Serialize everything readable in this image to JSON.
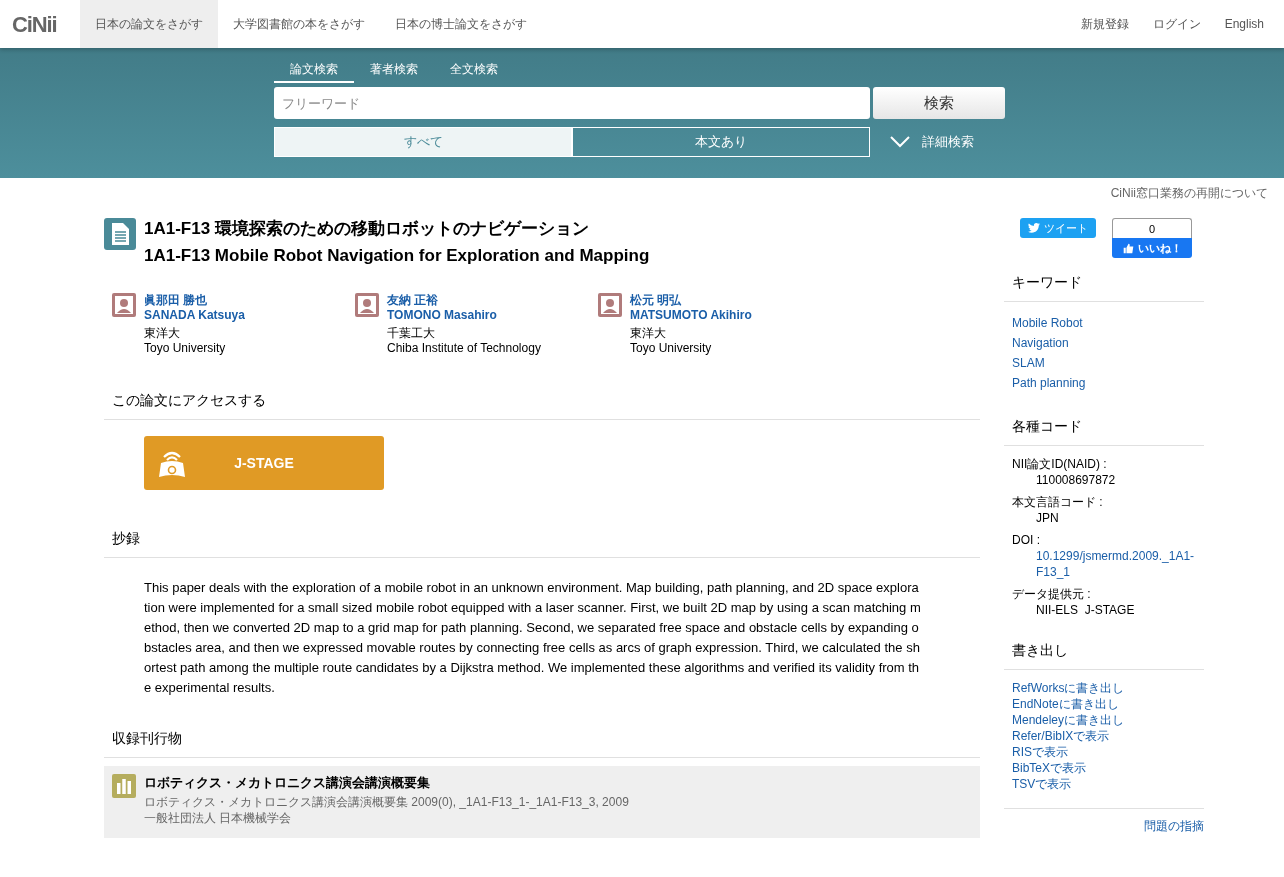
{
  "header": {
    "logo": "CiNii",
    "nav": [
      {
        "label": "日本の論文をさがす",
        "selected": true
      },
      {
        "label": "大学図書館の本をさがす",
        "selected": false
      },
      {
        "label": "日本の博士論文をさがす",
        "selected": false
      }
    ],
    "links": [
      "新規登録",
      "ログイン",
      "English"
    ]
  },
  "search": {
    "tabs": [
      {
        "label": "論文検索",
        "selected": true
      },
      {
        "label": "著者検索",
        "selected": false
      },
      {
        "label": "全文検索",
        "selected": false
      }
    ],
    "placeholder": "フリーワード",
    "button": "検索",
    "filters": [
      {
        "label": "すべて",
        "selected": true
      },
      {
        "label": "本文あり",
        "selected": false
      }
    ],
    "advanced": "詳細検索"
  },
  "notice": "CiNii窓口業務の再開について",
  "article": {
    "title_ja": "1A1-F13 環境探索のための移動ロボットのナビゲーション",
    "title_en": "1A1-F13 Mobile Robot Navigation for Exploration and Mapping",
    "authors": [
      {
        "name_ja": "眞那田 勝也",
        "name_en": "SANADA Katsuya",
        "affiliation_ja": "東洋大",
        "affiliation_en": "Toyo University"
      },
      {
        "name_ja": "友納 正裕",
        "name_en": "TOMONO Masahiro",
        "affiliation_ja": "千葉工大",
        "affiliation_en": "Chiba Institute of Technology"
      },
      {
        "name_ja": "松元 明弘",
        "name_en": "MATSUMOTO Akihiro",
        "affiliation_ja": "東洋大",
        "affiliation_en": "Toyo University"
      }
    ],
    "access_heading": "この論文にアクセスする",
    "access_button": "J-STAGE",
    "abstract_heading": "抄録",
    "abstract": "This paper deals with the exploration of a mobile robot in an unknown environment. Map building, path planning, and 2D space exploration were implemented for a small sized mobile robot equipped with a laser scanner. First, we built 2D map by using a scan matching method, then we converted 2D map to a grid map for path planning. Second, we separated free space and obstacle cells by expanding obstacles area, and then we expressed movable routes by connecting free cells as arcs of graph expression. Third, we calculated the shortest path among the multiple route candidates by a Dijkstra method. We implemented these algorithms and verified its validity from the experimental results.",
    "journal_heading": "収録刊行物",
    "journal": {
      "title": "ロボティクス・メカトロニクス講演会講演概要集",
      "detail": "ロボティクス・メカトロニクス講演会講演概要集 2009(0), _1A1-F13_1-_1A1-F13_3, 2009",
      "publisher": "一般社団法人 日本機械学会"
    }
  },
  "sidebar": {
    "tweet": "ツイート",
    "like_count": "0",
    "like": "いいね！",
    "keywords_heading": "キーワード",
    "keywords": [
      "Mobile Robot",
      "Navigation",
      "SLAM",
      "Path planning"
    ],
    "codes_heading": "各種コード",
    "codes": [
      {
        "kind": "text",
        "label": "NII論文ID(NAID) :",
        "value": "110008697872"
      },
      {
        "kind": "text",
        "label": "本文言語コード :",
        "value": "JPN"
      },
      {
        "kind": "link",
        "label": "DOI :",
        "value": "10.1299/jsmermd.2009._1A1-F13_1"
      },
      {
        "kind": "text",
        "label": "データ提供元 :",
        "value": "NII-ELS  J-STAGE"
      }
    ],
    "export_heading": "書き出し",
    "exports": [
      "RefWorksに書き出し",
      "EndNoteに書き出し",
      "Mendeleyに書き出し",
      "Refer/BibIXで表示",
      "RISで表示",
      "BibTeXで表示",
      "TSVで表示"
    ],
    "report": "問題の指摘"
  }
}
